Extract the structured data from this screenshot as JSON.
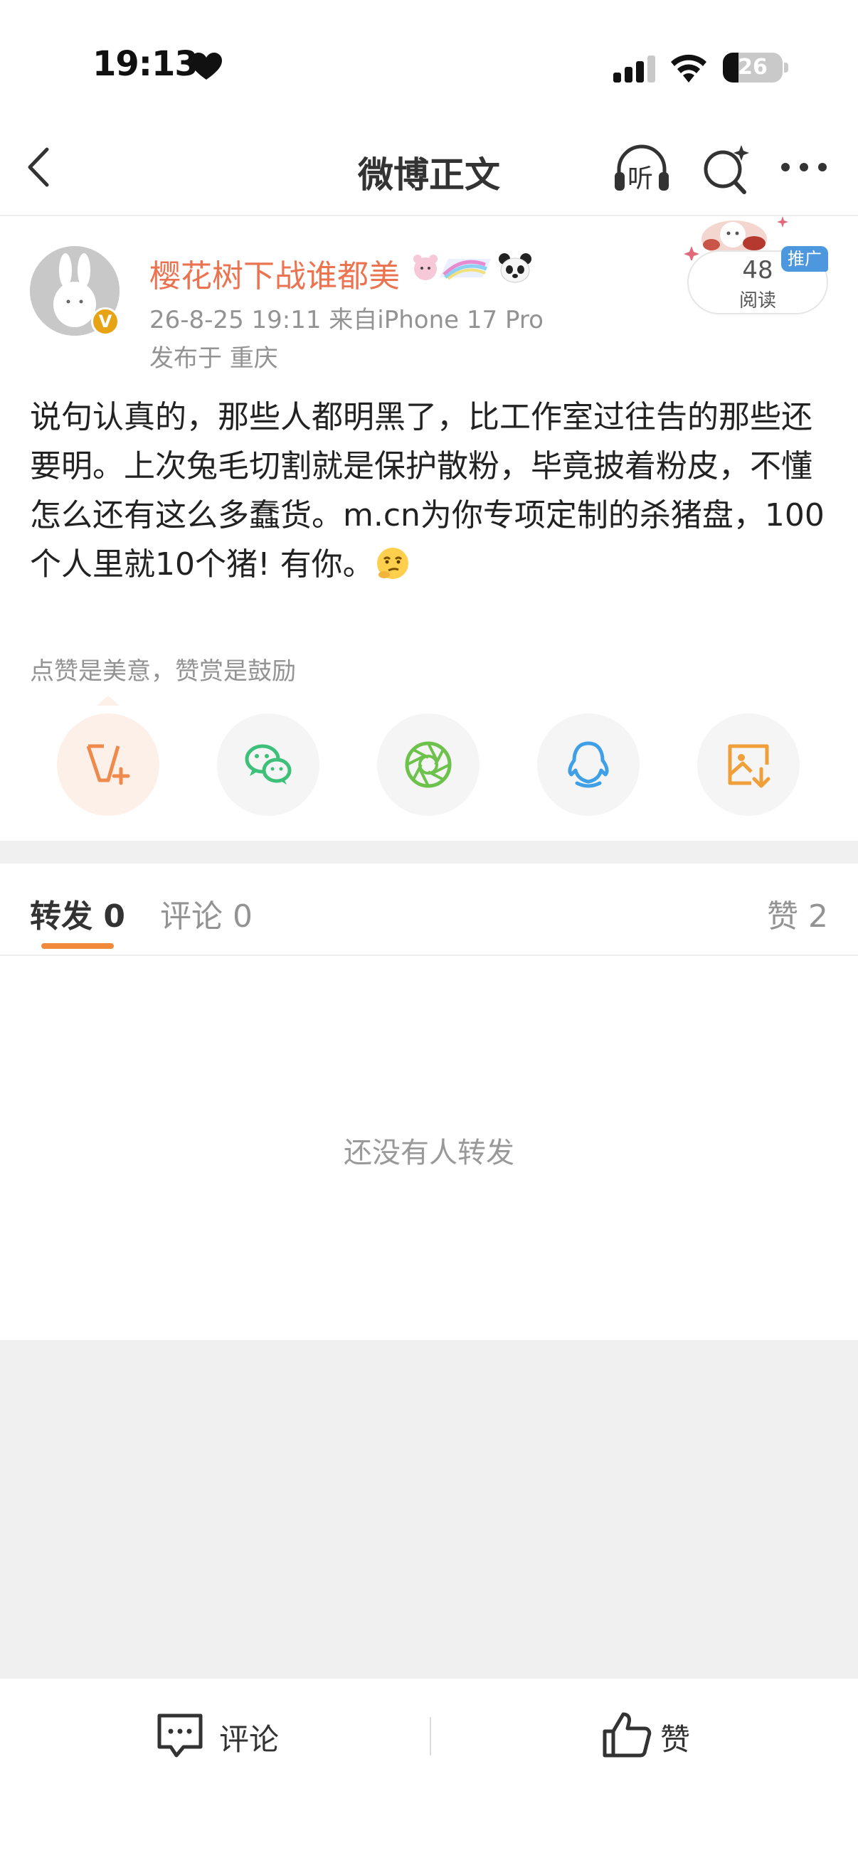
{
  "status_bar": {
    "time": "19:13",
    "battery": "26",
    "battery_level_percent": 26
  },
  "nav": {
    "title": "微博正文",
    "icons": [
      "back-icon",
      "headphones-listen-icon",
      "search-sparkle-icon",
      "more-icon"
    ],
    "listen_label": "听"
  },
  "post": {
    "author": "樱花树下战谁都美",
    "verified_badge": "V",
    "time_and_source": "26-8-25 19:11  来自iPhone 17 Pro",
    "location": "发布于 重庆",
    "read_count": "48",
    "read_label": "阅读",
    "promo_tag": "推广",
    "text": "说句认真的，那些人都明黑了，比工作室过往告的那些还要明。上次兔毛切割就是保护散粉，毕竟披着粉皮，不懂怎么还有这么多蠢货。m.cn为你专项定制的杀猪盘，100个人里就10个猪! 有你。",
    "praise_hint": "点赞是美意，赞赏是鼓励"
  },
  "share": {
    "items": [
      "v-plus-icon",
      "wechat-icon",
      "moments-icon",
      "qq-icon",
      "save-image-icon"
    ]
  },
  "tabs": {
    "repost": "转发 0",
    "comment": "评论 0",
    "like": "赞 2"
  },
  "empty_state": "还没有人转发",
  "bottom_bar": {
    "comment": "评论",
    "like": "赞"
  },
  "colors": {
    "username": "#eb7350",
    "accent": "#f08a3a",
    "gray_text": "#939393",
    "promo": "#4d97df"
  }
}
